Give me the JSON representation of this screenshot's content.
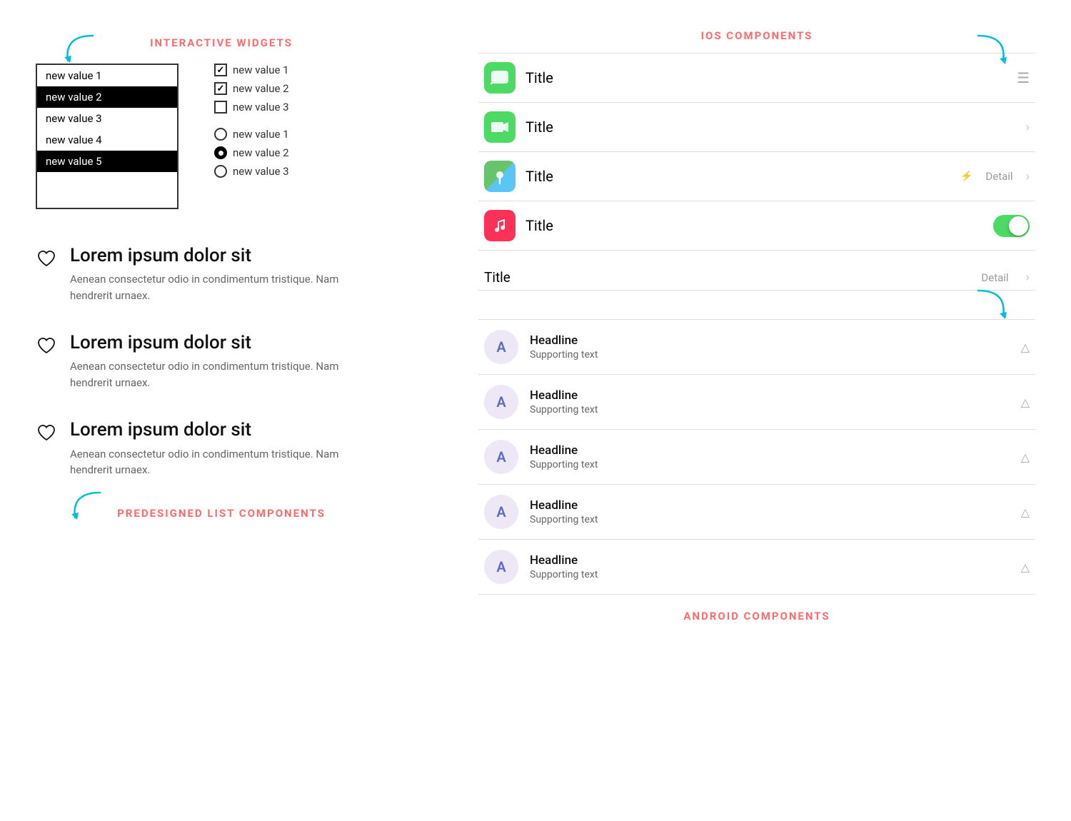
{
  "left": {
    "interactive_widgets_label": "INTERACTIVE WIDGETS",
    "listbox_items": [
      {
        "label": "new value 1",
        "selected": false
      },
      {
        "label": "new value 2",
        "selected": true
      },
      {
        "label": "new value 3",
        "selected": false
      },
      {
        "label": "new value 4",
        "selected": false
      },
      {
        "label": "new value 5",
        "selected": true
      }
    ],
    "checkboxes": [
      {
        "label": "new value 1",
        "checked": true
      },
      {
        "label": "new value 2",
        "checked": true
      },
      {
        "label": "new value 3",
        "checked": false
      }
    ],
    "radios": [
      {
        "label": "new value 1",
        "checked": false
      },
      {
        "label": "new value 2",
        "checked": true
      },
      {
        "label": "new value 3",
        "checked": false
      }
    ],
    "list_components_label": "PREDESIGNED LIST COMPONENTS",
    "list_items": [
      {
        "title": "Lorem ipsum dolor sit",
        "description": "Aenean consectetur odio in condimentum tristique. Nam hendrerit urnaex."
      },
      {
        "title": "Lorem ipsum dolor sit",
        "description": "Aenean consectetur odio in condimentum tristique. Nam hendrerit urnaex."
      },
      {
        "title": "Lorem ipsum dolor sit",
        "description": "Aenean consectetur odio in condimentum tristique. Nam hendrerit urnaex."
      }
    ]
  },
  "right": {
    "ios_label": "IOS COMPONENTS",
    "ios_rows": [
      {
        "title": "Title",
        "accessory": "menu"
      },
      {
        "title": "Title",
        "accessory": "chevron"
      },
      {
        "title": "Title",
        "detail": "Detail",
        "lightning": true,
        "accessory": "chevron"
      },
      {
        "title": "Title",
        "accessory": "toggle"
      }
    ],
    "title_detail_label": "Title",
    "title_detail_detail": "Detail",
    "android_label": "ANDROID COMPONENTS",
    "android_rows": [
      {
        "avatar": "A",
        "headline": "Headline",
        "supporting": "Supporting text"
      },
      {
        "avatar": "A",
        "headline": "Headline",
        "supporting": "Supporting text"
      },
      {
        "avatar": "A",
        "headline": "Headline",
        "supporting": "Supporting text"
      },
      {
        "avatar": "A",
        "headline": "Headline",
        "supporting": "Supporting text"
      },
      {
        "avatar": "A",
        "headline": "Headline",
        "supporting": "Supporting text"
      }
    ]
  },
  "icons": {
    "messages": "💬",
    "facetime": "📹",
    "maps": "🗺",
    "music": "🎵"
  }
}
